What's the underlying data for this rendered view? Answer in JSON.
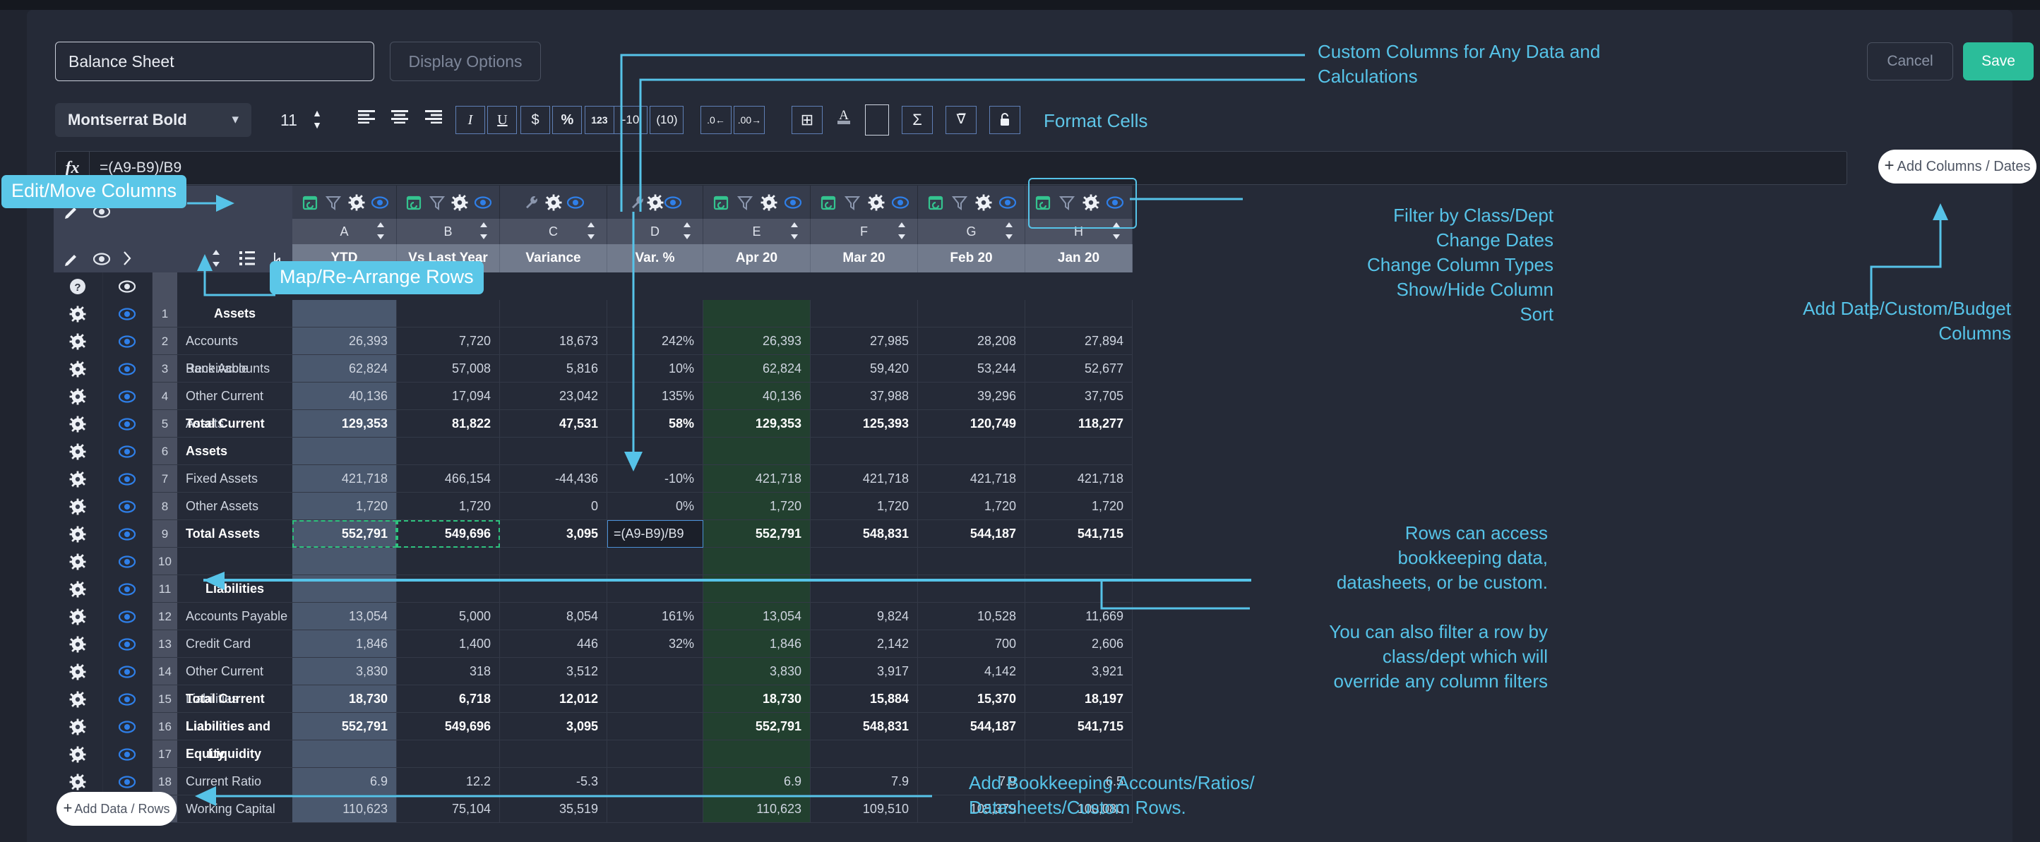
{
  "header": {
    "title_value": "Balance Sheet",
    "display_options_label": "Display Options",
    "cancel_label": "Cancel",
    "save_label": "Save",
    "accent_color": "#2bbd9a",
    "annotation_color": "#56c3e8"
  },
  "toolbar": {
    "font_family_value": "Montserrat Bold",
    "font_size_value": "11",
    "icons": [
      {
        "name": "align-left-icon",
        "glyph": "≡"
      },
      {
        "name": "align-center-icon",
        "glyph": "≡"
      },
      {
        "name": "align-right-icon",
        "glyph": "≡"
      },
      {
        "name": "italic-icon",
        "glyph": "I"
      },
      {
        "name": "underline-icon",
        "glyph": "U"
      },
      {
        "name": "currency-icon",
        "glyph": "$"
      },
      {
        "name": "percent-icon",
        "glyph": "%"
      },
      {
        "name": "number-format-icon",
        "glyph": "123"
      },
      {
        "name": "negative-format-icon",
        "glyph": "-10"
      },
      {
        "name": "parenthesis-format-icon",
        "glyph": "(10)"
      },
      {
        "name": "decrease-decimal-icon",
        "glyph": ".0"
      },
      {
        "name": "increase-decimal-icon",
        "glyph": ".00"
      },
      {
        "name": "borders-icon",
        "glyph": "⊞"
      },
      {
        "name": "text-color-icon",
        "glyph": "A"
      },
      {
        "name": "fill-color-icon",
        "glyph": ""
      },
      {
        "name": "sum-icon",
        "glyph": "Σ"
      },
      {
        "name": "filter-icon",
        "glyph": "∇"
      },
      {
        "name": "lock-icon",
        "glyph": "🔒"
      }
    ],
    "format_cells_label": "Format Cells"
  },
  "formula_bar": {
    "fx_label": "fx",
    "value": "=(A9-B9)/B9"
  },
  "buttons": {
    "add_columns_dates": "Add Columns / Dates",
    "add_data_rows": "Add Data / Rows",
    "plus_glyph": "+"
  },
  "grid": {
    "column_letters": [
      "A",
      "B",
      "C",
      "D",
      "E",
      "F",
      "G",
      "H"
    ],
    "column_names": [
      "YTD",
      "Vs Last Year",
      "Variance",
      "Var. %",
      "Apr 20",
      "Mar 20",
      "Feb 20",
      "Jan 20"
    ],
    "column_icons": {
      "calendar": "calendar-refresh-icon",
      "filter": "funnel-filter-icon",
      "gear": "gear-settings-icon",
      "eye": "eye-visibility-icon",
      "wrench": "wrench-tool-icon",
      "sort": "sort-updown-icon"
    },
    "gutter_tools": [
      {
        "name": "edit-pencil-icon"
      },
      {
        "name": "eye-visibility-icon"
      },
      {
        "name": "chevron-right-icon"
      },
      {
        "name": "sort-updown-icon"
      },
      {
        "name": "map-rearrange-rows-icon"
      },
      {
        "name": "collapse-arrow-icon"
      }
    ],
    "help_row_icons": [
      "help-question-icon",
      "eye-visibility-icon"
    ],
    "selected_column_letter": "H",
    "selected_cell_value": "=(A9-B9)/B9",
    "rows": [
      {
        "num": "1",
        "label": "Assets",
        "style": "section",
        "values": [
          "",
          "",
          "",
          "",
          "",
          "",
          "",
          ""
        ]
      },
      {
        "num": "2",
        "label": "Accounts Receivable",
        "style": "normal",
        "values": [
          "26,393",
          "7,720",
          "18,673",
          "242%",
          "26,393",
          "27,985",
          "28,208",
          "27,894"
        ]
      },
      {
        "num": "3",
        "label": "Bank Accounts",
        "style": "normal",
        "values": [
          "62,824",
          "57,008",
          "5,816",
          "10%",
          "62,824",
          "59,420",
          "53,244",
          "52,677"
        ]
      },
      {
        "num": "4",
        "label": "Other Current Assets",
        "style": "normal",
        "values": [
          "40,136",
          "17,094",
          "23,042",
          "135%",
          "40,136",
          "37,988",
          "39,296",
          "37,705"
        ]
      },
      {
        "num": "5",
        "label": "Total Current Assets",
        "style": "total",
        "values": [
          "129,353",
          "81,822",
          "47,531",
          "58%",
          "129,353",
          "125,393",
          "120,749",
          "118,277"
        ]
      },
      {
        "num": "6",
        "label": "",
        "style": "normal",
        "values": [
          "",
          "",
          "",
          "",
          "",
          "",
          "",
          ""
        ]
      },
      {
        "num": "7",
        "label": "Fixed Assets",
        "style": "normal",
        "values": [
          "421,718",
          "466,154",
          "-44,436",
          "-10%",
          "421,718",
          "421,718",
          "421,718",
          "421,718"
        ]
      },
      {
        "num": "8",
        "label": "Other Assets",
        "style": "normal",
        "values": [
          "1,720",
          "1,720",
          "0",
          "0%",
          "1,720",
          "1,720",
          "1,720",
          "1,720"
        ]
      },
      {
        "num": "9",
        "label": "Total Assets",
        "style": "total",
        "values": [
          "552,791",
          "549,696",
          "3,095",
          "",
          "552,791",
          "548,831",
          "544,187",
          "541,715"
        ]
      },
      {
        "num": "10",
        "label": "",
        "style": "normal",
        "values": [
          "",
          "",
          "",
          "",
          "",
          "",
          "",
          ""
        ]
      },
      {
        "num": "11",
        "label": "Liabilities",
        "style": "section",
        "values": [
          "",
          "",
          "",
          "",
          "",
          "",
          "",
          ""
        ]
      },
      {
        "num": "12",
        "label": "Accounts Payable",
        "style": "normal",
        "values": [
          "13,054",
          "5,000",
          "8,054",
          "161%",
          "13,054",
          "9,824",
          "10,528",
          "11,669"
        ]
      },
      {
        "num": "13",
        "label": "Credit Card",
        "style": "normal",
        "values": [
          "1,846",
          "1,400",
          "446",
          "32%",
          "1,846",
          "2,142",
          "700",
          "2,606"
        ]
      },
      {
        "num": "14",
        "label": "Other Current Liabilities",
        "style": "normal",
        "values": [
          "3,830",
          "318",
          "3,512",
          "",
          "3,830",
          "3,917",
          "4,142",
          "3,921"
        ]
      },
      {
        "num": "15",
        "label": "Total Current Liabilities",
        "style": "total",
        "values": [
          "18,730",
          "6,718",
          "12,012",
          "",
          "18,730",
          "15,884",
          "15,370",
          "18,197"
        ]
      },
      {
        "num": "16",
        "label": "Liabilities and Equity",
        "style": "total",
        "values": [
          "552,791",
          "549,696",
          "3,095",
          "",
          "552,791",
          "548,831",
          "544,187",
          "541,715"
        ]
      },
      {
        "num": "17",
        "label": "Liquidity",
        "style": "section",
        "values": [
          "",
          "",
          "",
          "",
          "",
          "",
          "",
          ""
        ]
      },
      {
        "num": "18",
        "label": "Current Ratio",
        "style": "normal",
        "values": [
          "6.9",
          "12.2",
          "-5.3",
          "",
          "6.9",
          "7.9",
          "7.9",
          "6.5"
        ]
      },
      {
        "num": "19",
        "label": "Working Capital",
        "style": "normal",
        "values": [
          "110,623",
          "75,104",
          "35,519",
          "",
          "110,623",
          "109,510",
          "105,379",
          "100,080"
        ]
      }
    ]
  },
  "annotations": {
    "edit_move_columns": "Edit/Move Columns",
    "map_rearrange_rows": "Map/Re-Arrange Rows",
    "custom_columns": "Custom Columns for Any Data and\nCalculations",
    "column_menu_line1": "Filter by Class/Dept",
    "column_menu_line2": "Change Dates",
    "column_menu_line3": "Change Column Types",
    "column_menu_line4": "Show/Hide Column",
    "column_menu_line5": "Sort",
    "add_date_columns": "Add Date/Custom/Budget\nColumns",
    "rows_access_1": "Rows can access",
    "rows_access_2": "bookkeeping data,",
    "rows_access_3": "datasheets, or be custom.",
    "rows_filter_1": "You can also filter a row by",
    "rows_filter_2": "class/dept which will",
    "rows_filter_3": "override any column filters",
    "add_bookkeeping_1": "Add Bookkeeping Accounts/Ratios/",
    "add_bookkeeping_2": "Datasheets/Custom Rows."
  }
}
